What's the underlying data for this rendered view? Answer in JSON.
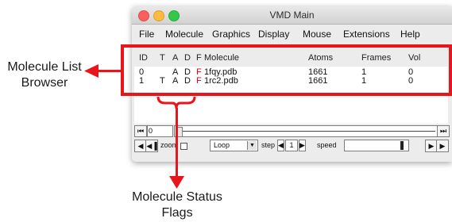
{
  "window": {
    "title": "VMD Main"
  },
  "menu": [
    "File",
    "Molecule",
    "Graphics",
    "Display",
    "Mouse",
    "Extensions",
    "Help"
  ],
  "columns": {
    "id": "ID",
    "t": "T",
    "a": "A",
    "d": "D",
    "f": "F",
    "molecule": "Molecule",
    "atoms": "Atoms",
    "frames": "Frames",
    "vol": "Vol"
  },
  "molecules": [
    {
      "id": "0",
      "t": "",
      "a": "A",
      "d": "D",
      "f": "F",
      "name": "1fqy.pdb",
      "atoms": "1661",
      "frames": "1",
      "vol": "0"
    },
    {
      "id": "1",
      "t": "T",
      "a": "A",
      "d": "D",
      "f": "F",
      "name": "1rc2.pdb",
      "atoms": "1661",
      "frames": "1",
      "vol": "0"
    }
  ],
  "animation": {
    "frame": "0",
    "zoom_label": "zoom",
    "style": "Loop",
    "step_label": "step",
    "step": "1",
    "speed_label": "speed"
  },
  "annotations": {
    "browser_label": "Molecule List\nBrowser",
    "flags_label": "Molecule Status\nFlags"
  },
  "colors": {
    "highlight": "#e8151c",
    "flag_f": "#d0021b"
  }
}
